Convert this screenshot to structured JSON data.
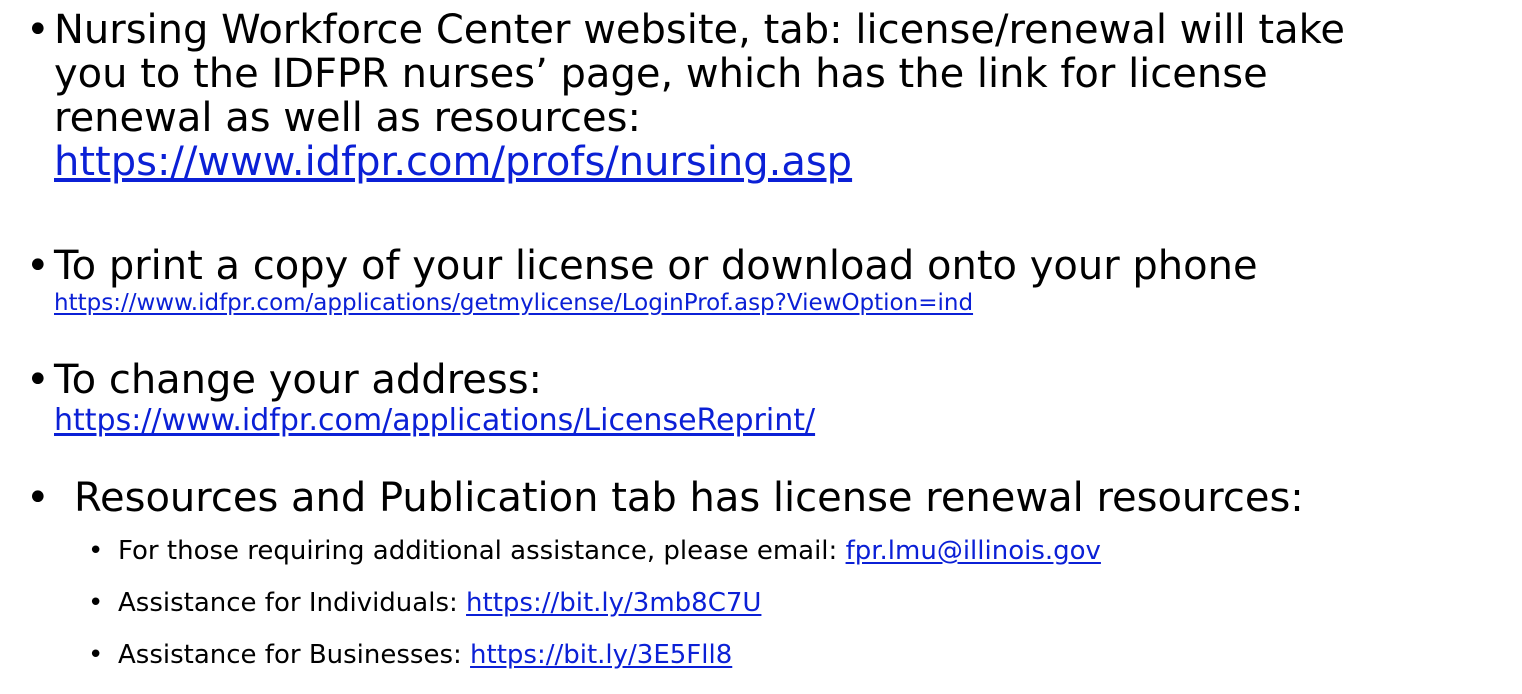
{
  "bullets": {
    "b1": {
      "line1": "Nursing Workforce Center website, tab: license/renewal will take",
      "line2": "you to the IDFPR nurses’ page, which has the link for license",
      "line3": "renewal as well as resources:",
      "link": "https://www.idfpr.com/profs/nursing.asp"
    },
    "b2": {
      "text": "To print a copy of your license or download onto your phone",
      "link": "https://www.idfpr.com/applications/getmylicense/LoginProf.asp?ViewOption=ind"
    },
    "b3": {
      "text": "To change your address:",
      "link": "https://www.idfpr.com/applications/LicenseReprint/"
    },
    "b4": {
      "text": "Resources and Publication tab has license renewal resources:",
      "subs": [
        {
          "text": "For those requiring additional assistance, please email: ",
          "link": "fpr.lmu@illinois.gov"
        },
        {
          "text": "Assistance for Individuals: ",
          "link": "https://bit.ly/3mb8C7U"
        },
        {
          "text": "Assistance for Businesses: ",
          "link": "https://bit.ly/3E5Fll8"
        }
      ]
    }
  },
  "bullet_char": "•"
}
